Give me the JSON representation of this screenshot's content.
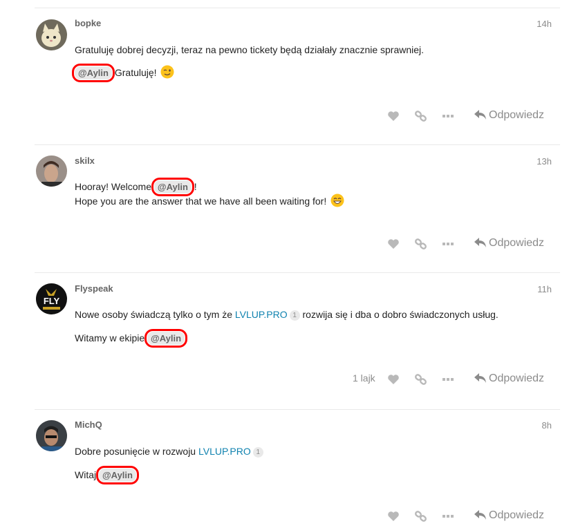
{
  "reply_label": "Odpowiedz",
  "posts": [
    {
      "username": "bopke",
      "time": "14h",
      "line1": "Gratuluję dobrej decyzji, teraz na pewno tickety będą działały znacznie sprawniej.",
      "mention": "@Aylin",
      "line2_after": " Gratuluję!"
    },
    {
      "username": "skilx",
      "time": "13h",
      "line1_before": "Hooray! Welcome ",
      "mention": "@Aylin",
      "line1_after": " !",
      "line2": "Hope you are the answer that we have all been waiting for!"
    },
    {
      "username": "Flyspeak",
      "time": "11h",
      "line1_before": "Nowe osoby świadczą tylko o tym że ",
      "link": "LVLUP.PRO",
      "link_count": "1",
      "line1_after": " rozwija się i dba o dobro świadczonych usług.",
      "line2_before": "Witamy w ekipie ",
      "mention": "@Aylin",
      "likes": "1 lajk"
    },
    {
      "username": "MichQ",
      "time": "8h",
      "line1_before": "Dobre posunięcie w rozwoju ",
      "link": "LVLUP.PRO",
      "link_count": "1",
      "line2_before": "Witaj ",
      "mention": "@Aylin"
    }
  ],
  "colors": {
    "highlight": "#ff0000",
    "link": "#0f82af",
    "muted": "#8b8b8b",
    "mention_bg": "#e9e9e9"
  }
}
